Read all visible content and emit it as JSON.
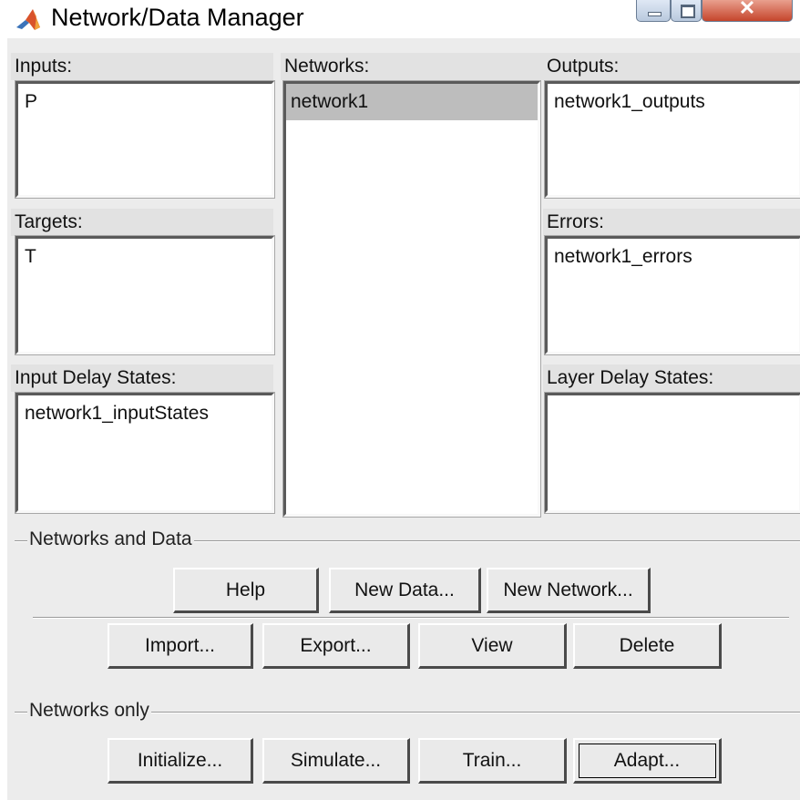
{
  "window": {
    "title": "Network/Data Manager"
  },
  "panels": {
    "inputs": {
      "label": "Inputs:",
      "items": [
        "P"
      ]
    },
    "networks": {
      "label": "Networks:",
      "items": [
        "network1"
      ]
    },
    "outputs": {
      "label": "Outputs:",
      "items": [
        "network1_outputs"
      ]
    },
    "targets": {
      "label": "Targets:",
      "items": [
        "T"
      ]
    },
    "errors": {
      "label": "Errors:",
      "items": [
        "network1_errors"
      ]
    },
    "input_delay_states": {
      "label": "Input Delay States:",
      "items": [
        "network1_inputStates"
      ]
    },
    "layer_delay_states": {
      "label": "Layer Delay States:",
      "items": []
    }
  },
  "networks_and_data": {
    "label": "Networks and Data",
    "help": "Help",
    "new_data": "New Data...",
    "new_network": "New Network...",
    "import": "Import...",
    "export": "Export...",
    "view": "View",
    "delete": "Delete"
  },
  "networks_only": {
    "label": "Networks only",
    "initialize": "Initialize...",
    "simulate": "Simulate...",
    "train": "Train...",
    "adapt": "Adapt..."
  },
  "colors": {
    "selection": "#bdbdbd",
    "dialog_bg": "#ececec"
  }
}
